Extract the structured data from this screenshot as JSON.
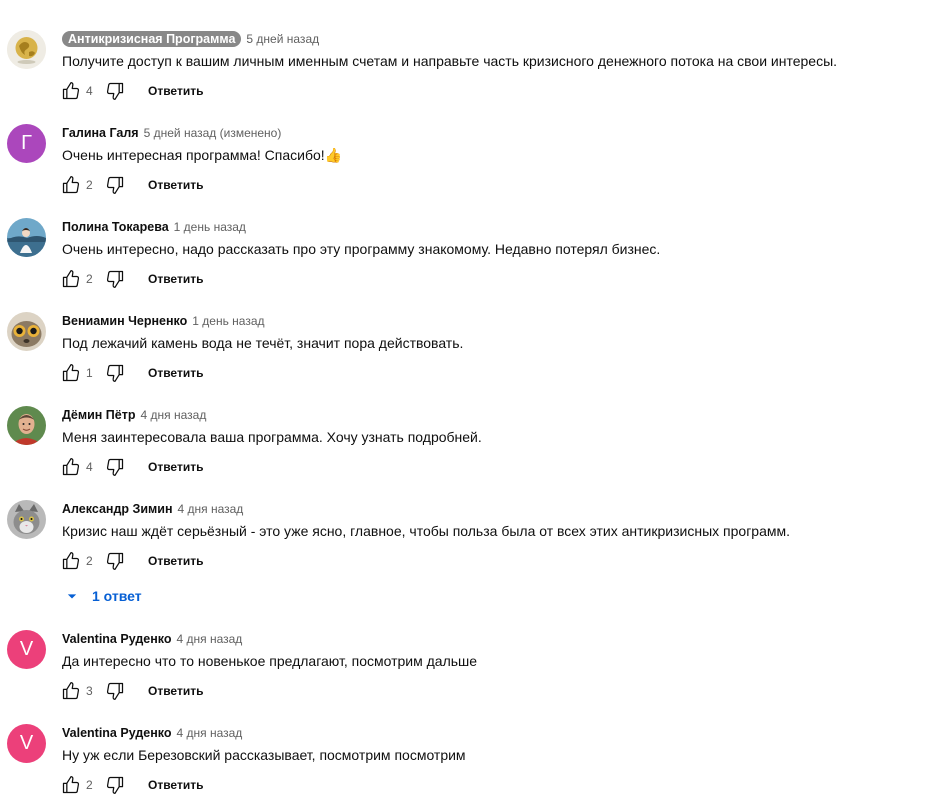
{
  "reply_label": "Ответить",
  "colors": {
    "link": "#065fd4",
    "avatar_g": "#ab47bc",
    "avatar_v": "#ec407a",
    "badge": "#888888"
  },
  "comments": [
    {
      "author": "Антикризисная Программа",
      "time": "5 дней назад",
      "text": "Получите доступ к вашим личным именным счетам и направьте часть кризисного денежного потока на свои интересы.",
      "likes": "4",
      "avatar_icon": "globe-avatar-icon"
    },
    {
      "author": "Галина Галя",
      "time": "5 дней назад (изменено)",
      "text": "Очень интересная программа! Спасибо!👍",
      "likes": "2",
      "avatar_letter": "Г"
    },
    {
      "author": "Полина Токарева",
      "time": "1 день назад",
      "text": "Очень интересно, надо рассказать про эту программу знакомому. Недавно потерял бизнес.",
      "likes": "2",
      "avatar_icon": "photo-avatar-icon"
    },
    {
      "author": "Вениамин Черненко",
      "time": "1 день назад",
      "text": "Под лежачий камень вода не течёт, значит пора действовать.",
      "likes": "1",
      "avatar_icon": "lemur-avatar-icon"
    },
    {
      "author": "Дёмин Пётр",
      "time": "4 дня назад",
      "text": "Меня заинтересовала ваша программа. Хочу узнать подробней.",
      "likes": "4",
      "avatar_icon": "person-avatar-icon"
    },
    {
      "author": "Александр Зимин",
      "time": "4 дня назад",
      "text": "Кризис наш ждёт серьёзный - это уже ясно, главное, чтобы польза была от всех этих антикризисных программ.",
      "likes": "2",
      "avatar_icon": "cat-avatar-icon",
      "replies": "1 ответ"
    },
    {
      "author": "Valentina Руденко",
      "time": "4 дня назад",
      "text": "Да интересно что то новенькое предлагают, посмотрим дальше",
      "likes": "3",
      "avatar_letter": "V"
    },
    {
      "author": "Valentina Руденко",
      "time": "4 дня назад",
      "text": "Ну уж если Березовский рассказывает, посмотрим посмотрим",
      "likes": "2",
      "avatar_letter": "V"
    }
  ]
}
